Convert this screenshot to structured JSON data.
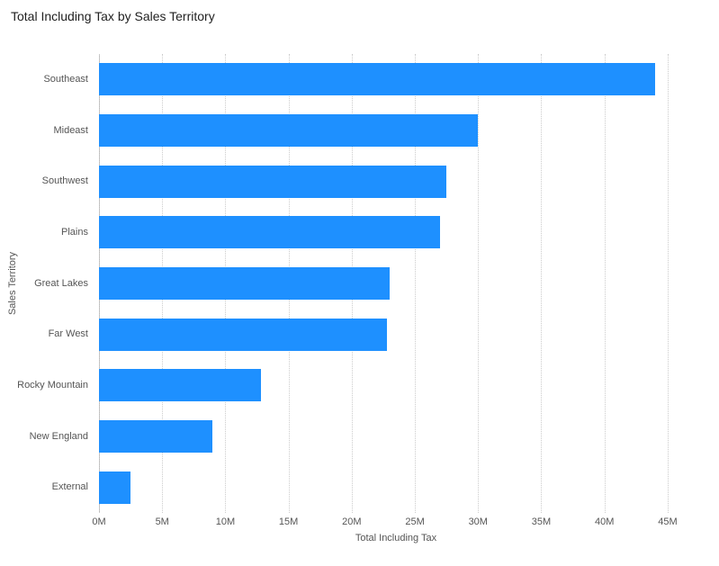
{
  "title": "Total Including Tax by Sales Territory",
  "xlabel": "Total Including Tax",
  "ylabel": "Sales Territory",
  "bar_color": "#1e90ff",
  "chart_data": {
    "type": "bar",
    "orientation": "horizontal",
    "title": "Total Including Tax by Sales Territory",
    "xlabel": "Total Including Tax",
    "ylabel": "Sales Territory",
    "xlim": [
      0,
      47000000
    ],
    "categories": [
      "Southeast",
      "Mideast",
      "Southwest",
      "Plains",
      "Great Lakes",
      "Far West",
      "Rocky Mountain",
      "New England",
      "External"
    ],
    "values": [
      44000000,
      30000000,
      27500000,
      27000000,
      23000000,
      22800000,
      12800000,
      9000000,
      2500000
    ],
    "x_ticks": [
      0,
      5000000,
      10000000,
      15000000,
      20000000,
      25000000,
      30000000,
      35000000,
      40000000,
      45000000
    ],
    "x_tick_labels": [
      "0M",
      "5M",
      "10M",
      "15M",
      "20M",
      "25M",
      "30M",
      "35M",
      "40M",
      "45M"
    ]
  }
}
